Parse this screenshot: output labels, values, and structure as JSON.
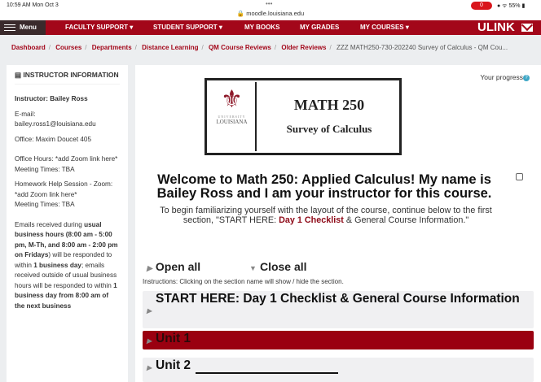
{
  "status": {
    "time": "10:59 AM  Mon Oct 3",
    "url": "moodle.louisiana.edu",
    "record": "0",
    "battery": "55%"
  },
  "nav": {
    "menu": "Menu",
    "items": [
      "FACULTY SUPPORT ▾",
      "STUDENT SUPPORT ▾",
      "MY BOOKS",
      "MY GRADES",
      "MY COURSES ▾"
    ],
    "logo": "ULINK"
  },
  "breadcrumb": [
    "Dashboard",
    "Courses",
    "Departments",
    "Distance Learning",
    "QM Course Reviews",
    "Older Reviews"
  ],
  "breadcrumb_current": "ZZZ MATH250-730-202240 Survey of Calculus - QM Cou...",
  "sidebar": {
    "title": "INSTRUCTOR INFORMATION",
    "instructor": "Instructor: Bailey Ross",
    "email_label": "E-mail:",
    "email": "bailey.ross1@louisiana.edu",
    "office": "Office: Maxim Doucet 405",
    "office_hours": "Office Hours: *add Zoom link here*",
    "meeting1": "Meeting Times: TBA",
    "hw": "Homework Help Session - Zoom: *add Zoom link here*",
    "meeting2": "Meeting Times:  TBA",
    "policy": [
      "Emails received during ",
      "usual business hours (8:00 am - 5:00 pm, M-Th, and 8:00 am - 2:00 pm on Fridays",
      ") will be responded to within ",
      "1 business day",
      "; emails received outside of usual business hours will be responded to within ",
      "1 business day from 8:00 am of the next business"
    ]
  },
  "main": {
    "progress": "Your progress",
    "banner_title": "MATH 250",
    "banner_subtitle": "Survey of Calculus",
    "logo_university": "UNIVERSITY",
    "logo_name": "LOUISIANA",
    "welcome": "Welcome to Math 250: Applied Calculus! My name is Bailey Ross and I am your instructor for this course.",
    "intro_pre": "To begin familiarizing yourself with the layout of the course, continue below to the first section, \"START HERE: ",
    "intro_link": "Day 1 Checklist",
    "intro_post": " & General Course Information.\"",
    "open_all": "Open all",
    "close_all": "Close all",
    "instructions": "Instructions: Clicking on the section name will show / hide the section.",
    "sections": [
      "START HERE: Day 1 Checklist & General Course Information",
      "Unit 1",
      "Unit 2"
    ]
  }
}
